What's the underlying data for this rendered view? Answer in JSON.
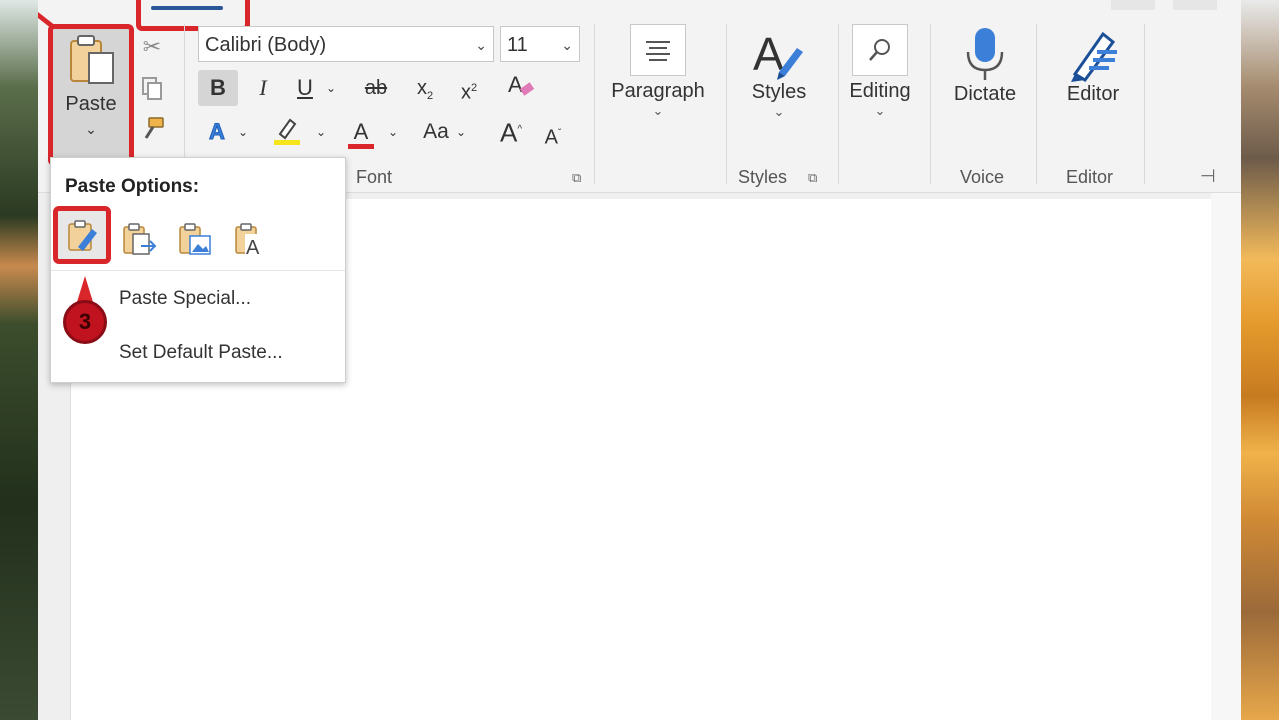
{
  "colors": {
    "highlight": "#d8262b",
    "accent": "#2b579a",
    "ribbon_bg": "#f3f3f3"
  },
  "clipboard": {
    "paste_label": "Paste",
    "paste_caret": "⌄"
  },
  "font": {
    "name": "Calibri (Body)",
    "size": "11",
    "group_label": "Font",
    "bold": "B",
    "italic": "I",
    "underline": "U",
    "strike": "ab",
    "subscript": "x",
    "superscript": "x",
    "text_effects": "A",
    "font_color": "A",
    "change_case": "Aa",
    "grow": "A",
    "shrink": "A"
  },
  "paragraph": {
    "label": "Paragraph"
  },
  "styles": {
    "label": "Styles",
    "group_label": "Styles"
  },
  "editing": {
    "label": "Editing"
  },
  "voice": {
    "label": "Dictate",
    "group_label": "Voice"
  },
  "editor": {
    "label": "Editor",
    "group_label": "Editor"
  },
  "paste_options": {
    "title": "Paste Options:",
    "items": [
      "Paste Special...",
      "Set Default Paste..."
    ],
    "step_number": "3"
  }
}
